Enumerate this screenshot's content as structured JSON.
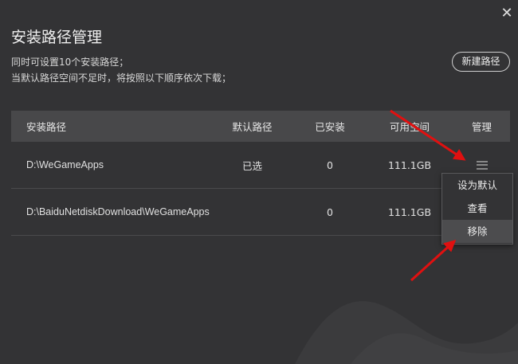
{
  "dialog": {
    "title": "安装路径管理",
    "desc_line1": "同时可设置10个安装路径；",
    "desc_line2": "当默认路径空间不足时，将按照以下顺序依次下载；",
    "new_path_label": "新建路径",
    "close_glyph": "✕"
  },
  "table": {
    "headers": {
      "path": "安装路径",
      "default": "默认路径",
      "installed": "已安装",
      "space": "可用空间",
      "manage": "管理"
    },
    "rows": [
      {
        "path": "D:\\WeGameApps",
        "default": "已选",
        "installed": "0",
        "space": "111.1GB"
      },
      {
        "path": "D:\\BaiduNetdiskDownload\\WeGameApps",
        "default": "",
        "installed": "0",
        "space": "111.1GB"
      }
    ]
  },
  "menu": {
    "items": [
      "设为默认",
      "查看",
      "移除"
    ],
    "hovered_index": 2
  },
  "colors": {
    "background": "#333335",
    "header_bg": "#48484a",
    "annotation_arrow": "#e01010"
  }
}
